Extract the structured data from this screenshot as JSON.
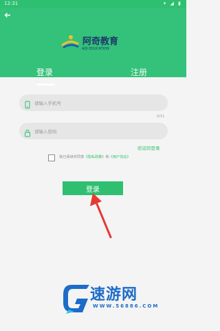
{
  "status": {
    "time": "12:31"
  },
  "header": {
    "logo_text": "阿奇教育",
    "logo_subtext": "AQI EDUCATION",
    "tabs": [
      {
        "label": "登录",
        "active": true
      },
      {
        "label": "注册",
        "active": false
      }
    ]
  },
  "form": {
    "phone_placeholder": "请输入手机号",
    "password_placeholder": "请输入密码",
    "counter": "0/11",
    "code_login_link": "验证码登录",
    "agreement": {
      "text": "我已阅读并同意",
      "privacy": "《隐私政策》",
      "and": "和",
      "user": "《用户协议》"
    },
    "login_button": "登录"
  },
  "watermark": {
    "title": "速游网",
    "url": "WWW.56886.COM"
  },
  "colors": {
    "accent": "#2fbf71",
    "header": "#34c17a",
    "watermark": "#1d6cc9",
    "arrow": "#e53935"
  }
}
